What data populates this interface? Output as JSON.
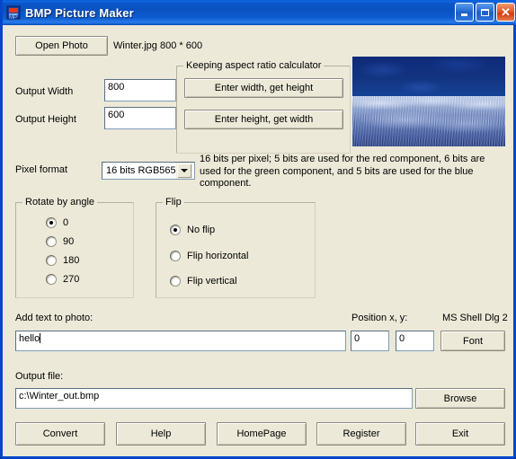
{
  "window": {
    "title": "BMP Picture Maker",
    "icon": "bmp-app-icon",
    "caption": {
      "minimize": "minimize-icon",
      "maximize": "maximize-icon",
      "close": "close-icon",
      "close_glyph": "✕"
    },
    "colors": {
      "titlebar_blue": "#0a52c2",
      "client_bg": "#ece9d8",
      "border": "#0546c9",
      "close_red": "#cf3c10"
    }
  },
  "toolbar": {
    "open_photo_label": "Open Photo",
    "file_info": "Winter.jpg 800 * 600"
  },
  "size": {
    "output_width_label": "Output Width",
    "output_width_value": "800",
    "output_height_label": "Output Height",
    "output_height_value": "600"
  },
  "aspect": {
    "group_title": "Keeping aspect ratio calculator",
    "enter_width_button": "Enter width, get height",
    "enter_height_button": "Enter height, get width"
  },
  "pixel_format": {
    "label": "Pixel format",
    "selected": "16 bits RGB565",
    "options": [
      "16 bits RGB565"
    ],
    "description": "16 bits per pixel; 5 bits are used for the red component, 6 bits are used for the green component, and 5 bits are used for the blue component."
  },
  "rotate": {
    "group_title": "Rotate by angle",
    "options": [
      {
        "label": "0",
        "checked": true
      },
      {
        "label": "90",
        "checked": false
      },
      {
        "label": "180",
        "checked": false
      },
      {
        "label": "270",
        "checked": false
      }
    ]
  },
  "flip": {
    "group_title": "Flip",
    "options": [
      {
        "label": "No flip",
        "checked": true
      },
      {
        "label": "Flip horizontal",
        "checked": false
      },
      {
        "label": "Flip vertical",
        "checked": false
      }
    ]
  },
  "text_overlay": {
    "label": "Add text to photo:",
    "value": "hello",
    "position_label": "Position x, y:",
    "position_x": "0",
    "position_y": "0",
    "font_name": "MS Shell Dlg 2",
    "font_button": "Font"
  },
  "output": {
    "label": "Output file:",
    "path": "c:\\Winter_out.bmp",
    "browse_button": "Browse"
  },
  "actions": {
    "convert": "Convert",
    "help": "Help",
    "homepage": "HomePage",
    "register": "Register",
    "exit": "Exit"
  },
  "photo": {
    "alt": "winter-photo-thumbnail"
  }
}
